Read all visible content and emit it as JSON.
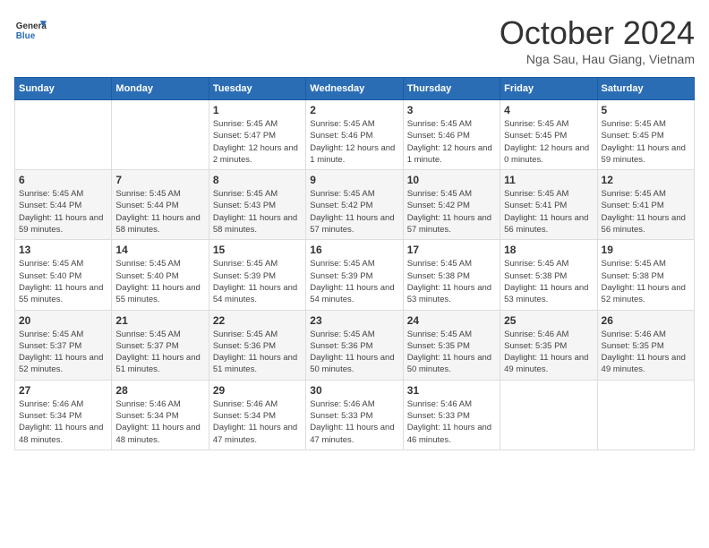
{
  "header": {
    "logo_general": "General",
    "logo_blue": "Blue",
    "month_title": "October 2024",
    "subtitle": "Nga Sau, Hau Giang, Vietnam"
  },
  "days_of_week": [
    "Sunday",
    "Monday",
    "Tuesday",
    "Wednesday",
    "Thursday",
    "Friday",
    "Saturday"
  ],
  "weeks": [
    [
      {
        "day": null,
        "data": null
      },
      {
        "day": null,
        "data": null
      },
      {
        "day": 1,
        "data": {
          "sunrise": "Sunrise: 5:45 AM",
          "sunset": "Sunset: 5:47 PM",
          "daylight": "Daylight: 12 hours and 2 minutes."
        }
      },
      {
        "day": 2,
        "data": {
          "sunrise": "Sunrise: 5:45 AM",
          "sunset": "Sunset: 5:46 PM",
          "daylight": "Daylight: 12 hours and 1 minute."
        }
      },
      {
        "day": 3,
        "data": {
          "sunrise": "Sunrise: 5:45 AM",
          "sunset": "Sunset: 5:46 PM",
          "daylight": "Daylight: 12 hours and 1 minute."
        }
      },
      {
        "day": 4,
        "data": {
          "sunrise": "Sunrise: 5:45 AM",
          "sunset": "Sunset: 5:45 PM",
          "daylight": "Daylight: 12 hours and 0 minutes."
        }
      },
      {
        "day": 5,
        "data": {
          "sunrise": "Sunrise: 5:45 AM",
          "sunset": "Sunset: 5:45 PM",
          "daylight": "Daylight: 11 hours and 59 minutes."
        }
      }
    ],
    [
      {
        "day": 6,
        "data": {
          "sunrise": "Sunrise: 5:45 AM",
          "sunset": "Sunset: 5:44 PM",
          "daylight": "Daylight: 11 hours and 59 minutes."
        }
      },
      {
        "day": 7,
        "data": {
          "sunrise": "Sunrise: 5:45 AM",
          "sunset": "Sunset: 5:44 PM",
          "daylight": "Daylight: 11 hours and 58 minutes."
        }
      },
      {
        "day": 8,
        "data": {
          "sunrise": "Sunrise: 5:45 AM",
          "sunset": "Sunset: 5:43 PM",
          "daylight": "Daylight: 11 hours and 58 minutes."
        }
      },
      {
        "day": 9,
        "data": {
          "sunrise": "Sunrise: 5:45 AM",
          "sunset": "Sunset: 5:42 PM",
          "daylight": "Daylight: 11 hours and 57 minutes."
        }
      },
      {
        "day": 10,
        "data": {
          "sunrise": "Sunrise: 5:45 AM",
          "sunset": "Sunset: 5:42 PM",
          "daylight": "Daylight: 11 hours and 57 minutes."
        }
      },
      {
        "day": 11,
        "data": {
          "sunrise": "Sunrise: 5:45 AM",
          "sunset": "Sunset: 5:41 PM",
          "daylight": "Daylight: 11 hours and 56 minutes."
        }
      },
      {
        "day": 12,
        "data": {
          "sunrise": "Sunrise: 5:45 AM",
          "sunset": "Sunset: 5:41 PM",
          "daylight": "Daylight: 11 hours and 56 minutes."
        }
      }
    ],
    [
      {
        "day": 13,
        "data": {
          "sunrise": "Sunrise: 5:45 AM",
          "sunset": "Sunset: 5:40 PM",
          "daylight": "Daylight: 11 hours and 55 minutes."
        }
      },
      {
        "day": 14,
        "data": {
          "sunrise": "Sunrise: 5:45 AM",
          "sunset": "Sunset: 5:40 PM",
          "daylight": "Daylight: 11 hours and 55 minutes."
        }
      },
      {
        "day": 15,
        "data": {
          "sunrise": "Sunrise: 5:45 AM",
          "sunset": "Sunset: 5:39 PM",
          "daylight": "Daylight: 11 hours and 54 minutes."
        }
      },
      {
        "day": 16,
        "data": {
          "sunrise": "Sunrise: 5:45 AM",
          "sunset": "Sunset: 5:39 PM",
          "daylight": "Daylight: 11 hours and 54 minutes."
        }
      },
      {
        "day": 17,
        "data": {
          "sunrise": "Sunrise: 5:45 AM",
          "sunset": "Sunset: 5:38 PM",
          "daylight": "Daylight: 11 hours and 53 minutes."
        }
      },
      {
        "day": 18,
        "data": {
          "sunrise": "Sunrise: 5:45 AM",
          "sunset": "Sunset: 5:38 PM",
          "daylight": "Daylight: 11 hours and 53 minutes."
        }
      },
      {
        "day": 19,
        "data": {
          "sunrise": "Sunrise: 5:45 AM",
          "sunset": "Sunset: 5:38 PM",
          "daylight": "Daylight: 11 hours and 52 minutes."
        }
      }
    ],
    [
      {
        "day": 20,
        "data": {
          "sunrise": "Sunrise: 5:45 AM",
          "sunset": "Sunset: 5:37 PM",
          "daylight": "Daylight: 11 hours and 52 minutes."
        }
      },
      {
        "day": 21,
        "data": {
          "sunrise": "Sunrise: 5:45 AM",
          "sunset": "Sunset: 5:37 PM",
          "daylight": "Daylight: 11 hours and 51 minutes."
        }
      },
      {
        "day": 22,
        "data": {
          "sunrise": "Sunrise: 5:45 AM",
          "sunset": "Sunset: 5:36 PM",
          "daylight": "Daylight: 11 hours and 51 minutes."
        }
      },
      {
        "day": 23,
        "data": {
          "sunrise": "Sunrise: 5:45 AM",
          "sunset": "Sunset: 5:36 PM",
          "daylight": "Daylight: 11 hours and 50 minutes."
        }
      },
      {
        "day": 24,
        "data": {
          "sunrise": "Sunrise: 5:45 AM",
          "sunset": "Sunset: 5:35 PM",
          "daylight": "Daylight: 11 hours and 50 minutes."
        }
      },
      {
        "day": 25,
        "data": {
          "sunrise": "Sunrise: 5:46 AM",
          "sunset": "Sunset: 5:35 PM",
          "daylight": "Daylight: 11 hours and 49 minutes."
        }
      },
      {
        "day": 26,
        "data": {
          "sunrise": "Sunrise: 5:46 AM",
          "sunset": "Sunset: 5:35 PM",
          "daylight": "Daylight: 11 hours and 49 minutes."
        }
      }
    ],
    [
      {
        "day": 27,
        "data": {
          "sunrise": "Sunrise: 5:46 AM",
          "sunset": "Sunset: 5:34 PM",
          "daylight": "Daylight: 11 hours and 48 minutes."
        }
      },
      {
        "day": 28,
        "data": {
          "sunrise": "Sunrise: 5:46 AM",
          "sunset": "Sunset: 5:34 PM",
          "daylight": "Daylight: 11 hours and 48 minutes."
        }
      },
      {
        "day": 29,
        "data": {
          "sunrise": "Sunrise: 5:46 AM",
          "sunset": "Sunset: 5:34 PM",
          "daylight": "Daylight: 11 hours and 47 minutes."
        }
      },
      {
        "day": 30,
        "data": {
          "sunrise": "Sunrise: 5:46 AM",
          "sunset": "Sunset: 5:33 PM",
          "daylight": "Daylight: 11 hours and 47 minutes."
        }
      },
      {
        "day": 31,
        "data": {
          "sunrise": "Sunrise: 5:46 AM",
          "sunset": "Sunset: 5:33 PM",
          "daylight": "Daylight: 11 hours and 46 minutes."
        }
      },
      {
        "day": null,
        "data": null
      },
      {
        "day": null,
        "data": null
      }
    ]
  ]
}
